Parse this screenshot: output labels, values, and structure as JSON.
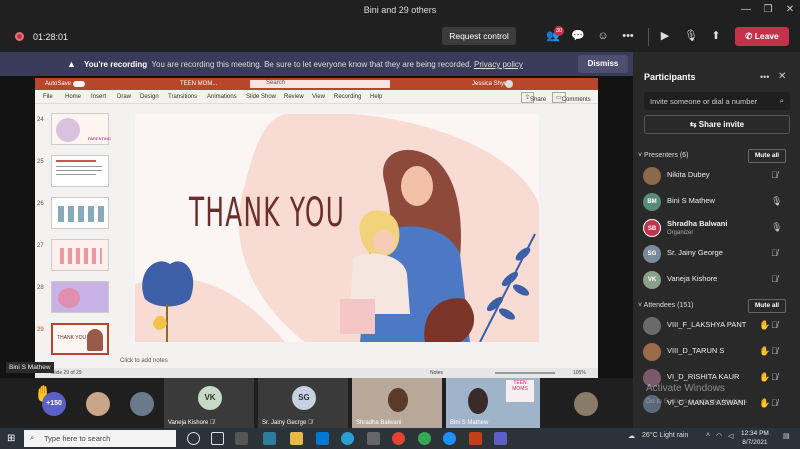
{
  "window": {
    "title": "Bini and 29 others"
  },
  "call": {
    "timer": "01:28:01",
    "request_control": "Request control",
    "participants_badge": "30",
    "leave": "Leave"
  },
  "recording": {
    "title": "You're recording",
    "message": "You are recording this meeting. Be sure to let everyone know that they are being recorded.",
    "link": "Privacy policy",
    "dismiss": "Dismiss"
  },
  "ppt": {
    "autosave": "AutoSave",
    "doc_title": "TEEN MOM...",
    "search": "Search",
    "user": "Jessica Shynu",
    "menu": [
      "File",
      "Home",
      "Insert",
      "Draw",
      "Design",
      "Transitions",
      "Animations",
      "Slide Show",
      "Review",
      "View",
      "Recording",
      "Help"
    ],
    "share": "Share",
    "comments": "Comments",
    "slide_numbers": [
      "24",
      "25",
      "26",
      "27",
      "28",
      "29"
    ],
    "slide_text": "THANK YOU",
    "thumb_24_text": "PARENTING",
    "thumb_29_text": "THANK YOU",
    "notes_placeholder": "Click to add notes",
    "status_left": "Slide 29 of 29",
    "status_notes": "Notes",
    "zoom": "105%"
  },
  "participants": {
    "title": "Participants",
    "invite_placeholder": "Invite someone or dial a number",
    "share_invite": "Share invite",
    "presenters_label": "Presenters (6)",
    "attendees_label": "Attendees (151)",
    "mute_all": "Mute all",
    "presenters": [
      {
        "name": "Nikita Dubey",
        "initials": "",
        "color": "#8a6a4a",
        "role": ""
      },
      {
        "name": "Bini S Mathew",
        "initials": "BM",
        "color": "#5b8a7a",
        "role": ""
      },
      {
        "name": "Shradha Balwani",
        "initials": "SB",
        "color": "#c4314b",
        "role": "Organizer"
      },
      {
        "name": "Sr. Jainy George",
        "initials": "SG",
        "color": "#7a8a9a",
        "role": ""
      },
      {
        "name": "Vaneja Kishore",
        "initials": "VK",
        "color": "#8aa08a",
        "role": ""
      }
    ],
    "attendees": [
      {
        "name": "VIII_F_LAKSHYA PANT",
        "initials": "",
        "color": "#6a6a6a"
      },
      {
        "name": "VIII_D_TARUN S",
        "initials": "",
        "color": "#9a6a4a"
      },
      {
        "name": "VI_D_RISHITA KAUR",
        "initials": "",
        "color": "#7a5a6a"
      },
      {
        "name": "VI_C_MANAS ASWANI",
        "initials": "",
        "color": "#5a6a7a"
      }
    ]
  },
  "gallery": {
    "overflow": "+150",
    "speaker_chip": "Bini S Mathew",
    "tiles": [
      {
        "name": "Vaneja Kishore",
        "initials": "VK"
      },
      {
        "name": "Sr. Jainy Gecrge",
        "initials": "SG"
      },
      {
        "name": "Shradha Balwani",
        "initials": ""
      },
      {
        "name": "Bini S Mathew",
        "initials": ""
      }
    ]
  },
  "windows_watermark": {
    "line1": "Activate Windows",
    "line2": "Go to Settings to activate Windows."
  },
  "taskbar": {
    "search_placeholder": "Type here to search",
    "weather": "26°C  Light rain",
    "time": "12:34 PM",
    "date": "8/7/2021"
  }
}
